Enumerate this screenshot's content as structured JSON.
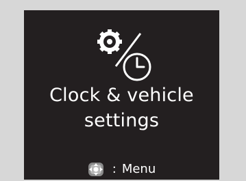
{
  "screen": {
    "icon_name": "clock-vehicle-settings-icon",
    "title_line1": "Clock & vehicle",
    "title_line2": "settings"
  },
  "hint": {
    "icon_name": "multi-directional-pad-icon",
    "separator": ":",
    "label": "Menu"
  }
}
